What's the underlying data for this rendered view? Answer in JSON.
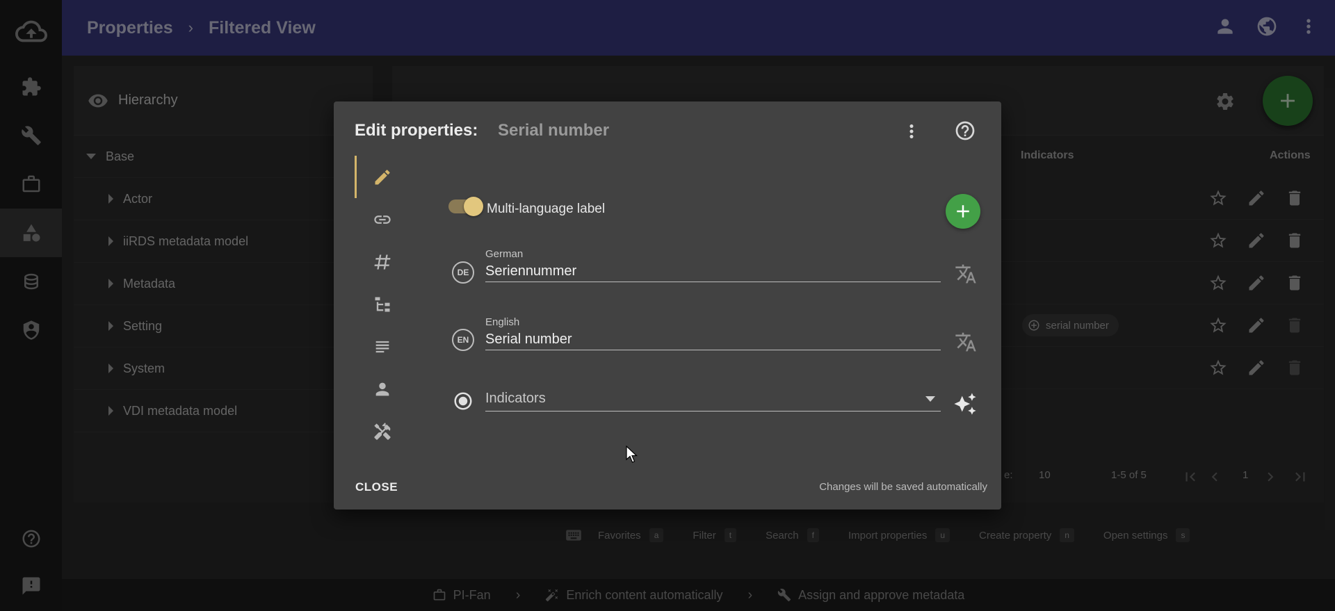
{
  "header": {
    "breadcrumb": [
      "Properties",
      "Filtered View"
    ],
    "icons": [
      "account-icon",
      "language-globe-icon",
      "more-vert-icon"
    ]
  },
  "rail": {
    "items": [
      "cloud-upload-logo",
      "extension-icon",
      "wrench-icon",
      "briefcase-icon",
      "shapes-icon",
      "database-icon",
      "shield-account-icon"
    ],
    "active_index": 4,
    "footer_items": [
      "help-icon",
      "feedback-icon"
    ]
  },
  "tree": {
    "view_label": "Hierarchy",
    "root": "Base",
    "items": [
      {
        "label": "Actor"
      },
      {
        "label": "iiRDS metadata model"
      },
      {
        "label": "Metadata"
      },
      {
        "label": "Setting"
      },
      {
        "label": "System"
      },
      {
        "label": "VDI metadata model"
      }
    ]
  },
  "list": {
    "columns": {
      "indicators": "Indicators",
      "actions": "Actions"
    },
    "chip_label": "serial number",
    "pagination": {
      "rows_label": "e:",
      "rows_per_page": "10",
      "range": "1-5 of 5",
      "page": "1"
    }
  },
  "dialog": {
    "title": "Edit properties:",
    "subtitle": "Serial number",
    "tabs": [
      "pencil-icon",
      "link-icon",
      "pound-icon",
      "file-tree-icon",
      "text-icon",
      "person-icon",
      "tools-icon"
    ],
    "active_tab": 0,
    "multilang_label": "Multi-language label",
    "multilang_enabled": true,
    "fields": [
      {
        "lang_code": "DE",
        "caption": "German",
        "value": "Seriennummer"
      },
      {
        "lang_code": "EN",
        "caption": "English",
        "value": "Serial number"
      }
    ],
    "indicators_placeholder": "Indicators",
    "close_label": "CLOSE",
    "autosave_note": "Changes will be saved automatically"
  },
  "shortcuts": [
    {
      "label": "Favorites",
      "key": "a"
    },
    {
      "label": "Filter",
      "key": "t"
    },
    {
      "label": "Search",
      "key": "f"
    },
    {
      "label": "Import properties",
      "key": "u"
    },
    {
      "label": "Create property",
      "key": "n"
    },
    {
      "label": "Open settings",
      "key": "s"
    }
  ],
  "workflow": [
    {
      "label": "PI-Fan"
    },
    {
      "label": "Enrich content automatically"
    },
    {
      "label": "Assign and approve metadata"
    }
  ],
  "colors": {
    "header": "#3a3a80",
    "accent": "#d4b56a",
    "fab_green": "#2e7d32",
    "add_green": "#43a047"
  }
}
